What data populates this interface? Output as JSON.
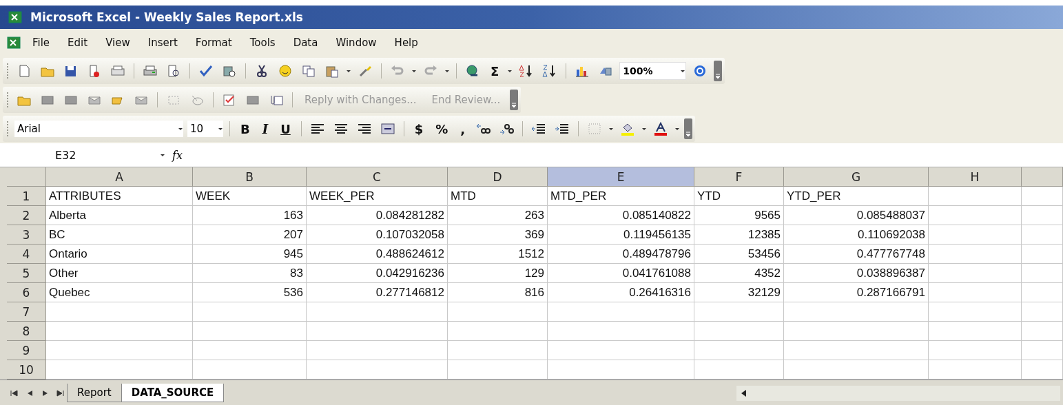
{
  "window": {
    "title": "Microsoft Excel - Weekly Sales Report.xls"
  },
  "menu": [
    "File",
    "Edit",
    "View",
    "Insert",
    "Format",
    "Tools",
    "Data",
    "Window",
    "Help"
  ],
  "standard_toolbar": {
    "sum": "Σ",
    "zoom": "100%"
  },
  "reviewing_toolbar": {
    "reply": "Reply with Changes...",
    "end_review": "End Review..."
  },
  "formatting_toolbar": {
    "font": "Arial",
    "size": "10",
    "bold": "B",
    "italic": "I",
    "underline": "U",
    "currency": "$",
    "percent": "%",
    "comma": ","
  },
  "formula_bar": {
    "name_box": "E32",
    "fx": "fx"
  },
  "columns": [
    {
      "label": "A",
      "selected": false
    },
    {
      "label": "B",
      "selected": false
    },
    {
      "label": "C",
      "selected": false
    },
    {
      "label": "D",
      "selected": false
    },
    {
      "label": "E",
      "selected": true
    },
    {
      "label": "F",
      "selected": false
    },
    {
      "label": "G",
      "selected": false
    },
    {
      "label": "H",
      "selected": false
    }
  ],
  "rows": [
    {
      "label": "1",
      "cells": [
        "ATTRIBUTES",
        "WEEK",
        "WEEK_PER",
        "MTD",
        "MTD_PER",
        "YTD",
        "YTD_PER"
      ]
    },
    {
      "label": "2",
      "cells": [
        "Alberta",
        "163",
        "0.084281282",
        "263",
        "0.085140822",
        "9565",
        "0.085488037"
      ]
    },
    {
      "label": "3",
      "cells": [
        "BC",
        "207",
        "0.107032058",
        "369",
        "0.119456135",
        "12385",
        "0.110692038"
      ]
    },
    {
      "label": "4",
      "cells": [
        "Ontario",
        "945",
        "0.488624612",
        "1512",
        "0.489478796",
        "53456",
        "0.477767748"
      ]
    },
    {
      "label": "5",
      "cells": [
        "Other",
        "83",
        "0.042916236",
        "129",
        "0.041761088",
        "4352",
        "0.038896387"
      ]
    },
    {
      "label": "6",
      "cells": [
        "Quebec",
        "536",
        "0.277146812",
        "816",
        "0.26416316",
        "32129",
        "0.287166791"
      ]
    },
    {
      "label": "7"
    },
    {
      "label": "8"
    },
    {
      "label": "9"
    },
    {
      "label": "10"
    }
  ],
  "sheet_tabs": [
    {
      "label": "Report",
      "selected": false
    },
    {
      "label": "DATA_SOURCE",
      "selected": true
    }
  ]
}
